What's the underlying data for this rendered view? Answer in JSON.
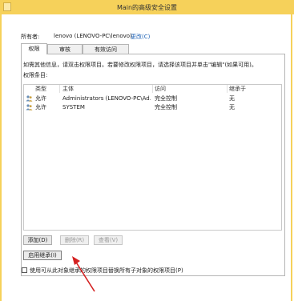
{
  "window": {
    "title": "Main的高级安全设置"
  },
  "owner": {
    "label": "所有者:",
    "value": "lenovo (LENOVO-PC\\lenovo)",
    "change_link": "更改(C)"
  },
  "tabs": [
    {
      "label": "权限",
      "active": true
    },
    {
      "label": "审核",
      "active": false
    },
    {
      "label": "有效访问",
      "active": false
    }
  ],
  "info": {
    "text": "如需其他信息，请双击权限项目。若要修改权限项目，请选择该项目并单击\"编辑\"(如果可用)。",
    "entries_label": "权限条目:"
  },
  "table": {
    "headers": {
      "type": "类型",
      "principal": "主体",
      "access": "访问",
      "inherited": "继承于"
    },
    "rows": [
      {
        "icon": "user-group-icon",
        "type": "允许",
        "principal": "Administrators (LENOVO-PC\\Ad...",
        "access": "完全控制",
        "inherited": "无"
      },
      {
        "icon": "user-group-icon",
        "type": "允许",
        "principal": "SYSTEM",
        "access": "完全控制",
        "inherited": "无"
      }
    ]
  },
  "buttons": {
    "add": "添加(D)",
    "remove": "删除(R)",
    "view": "查看(V)",
    "enable_inheritance": "启用继承(I)"
  },
  "replace_checkbox": {
    "label": "使用可从此对象继承的权限项目替换所有子对象的权限项目(P)",
    "checked": false
  },
  "colors": {
    "titlebar": "#f6d15a",
    "link": "#1a5fb4",
    "annotation_arrow": "#d42020"
  }
}
